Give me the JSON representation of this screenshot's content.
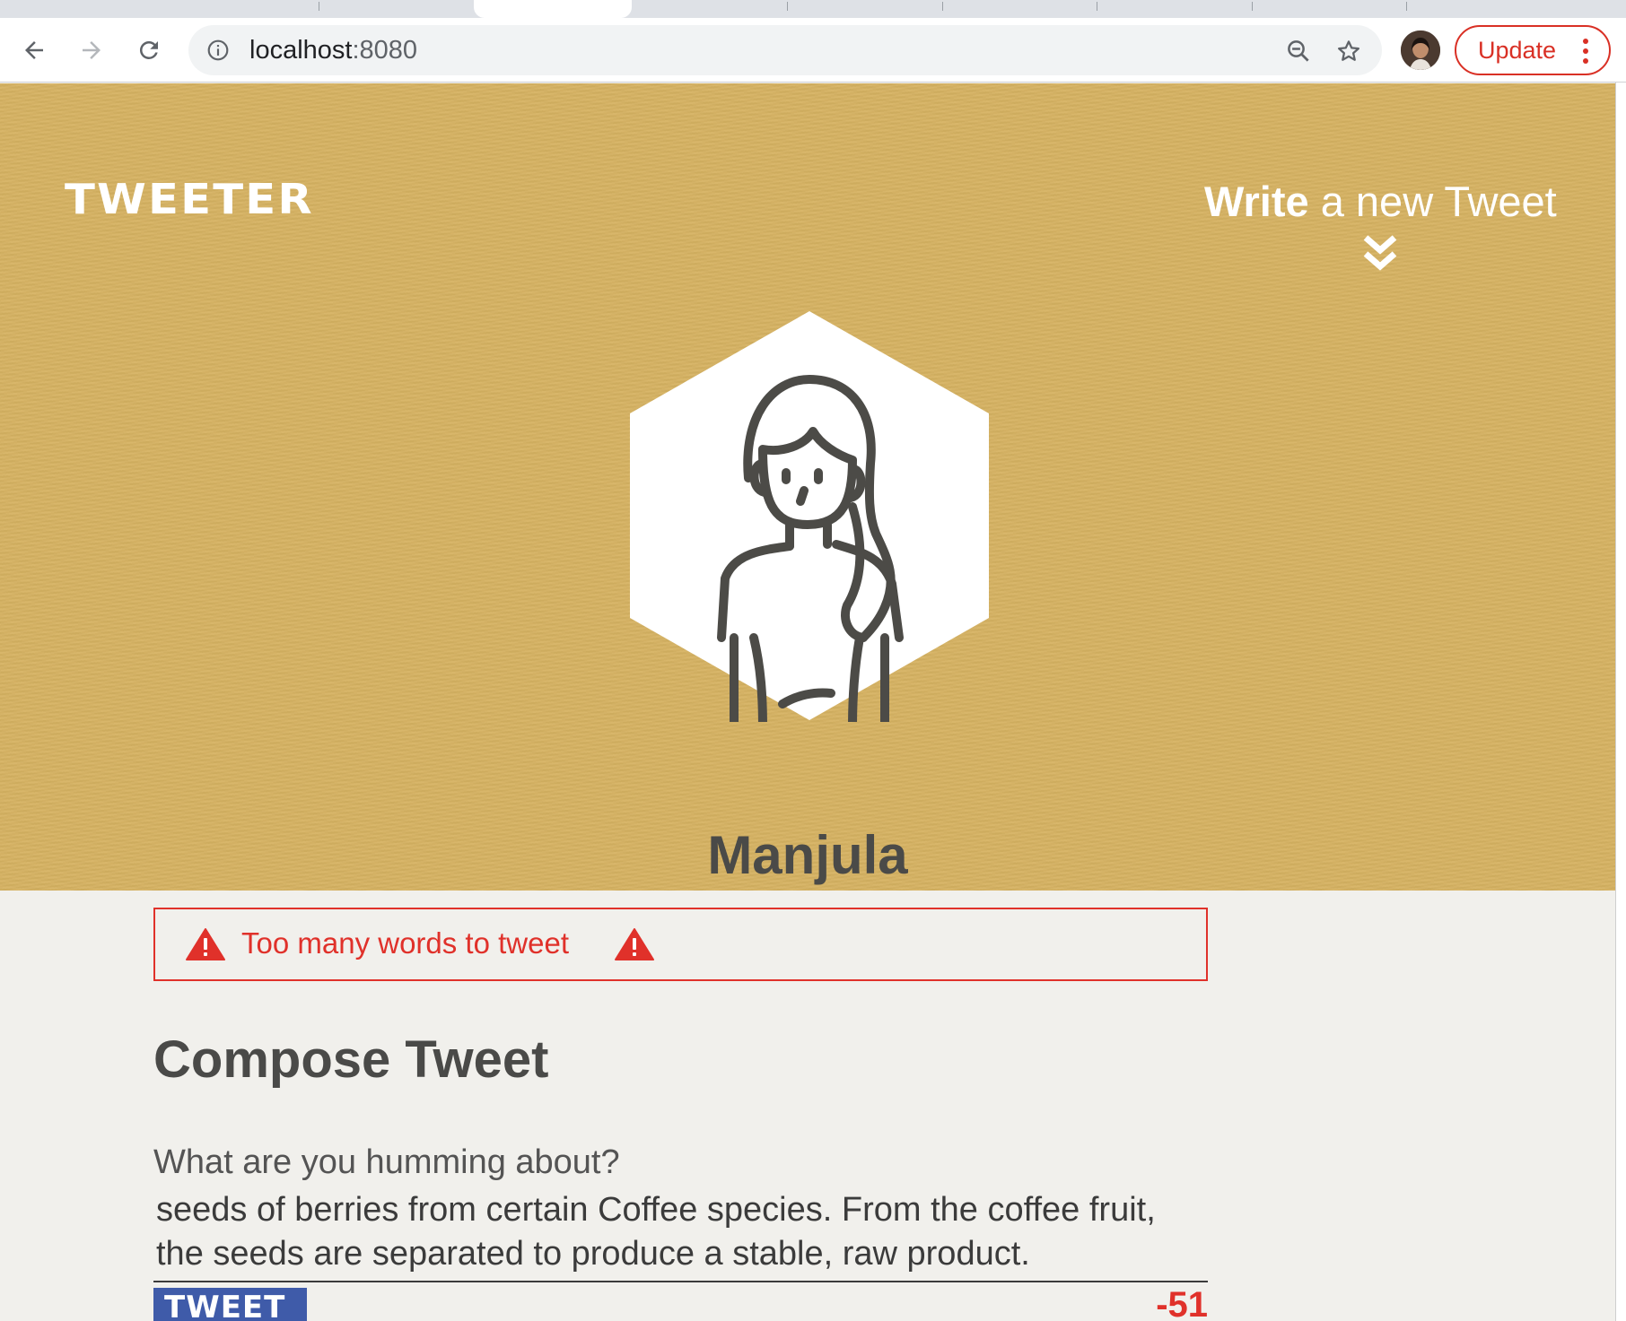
{
  "browser": {
    "url_host": "localhost",
    "url_port": ":8080",
    "update_label": "Update",
    "icons": {
      "back": "arrow-left-icon",
      "forward": "arrow-right-icon",
      "reload": "reload-icon",
      "site_info": "info-icon",
      "zoom": "zoom-out-icon",
      "bookmark": "star-icon",
      "menu": "kebab-menu-icon"
    }
  },
  "header": {
    "logo": "TWEETER",
    "write_bold": "Write",
    "write_rest": " a new Tweet",
    "user_name": "Manjula",
    "colors": {
      "background": "#d6b262",
      "text": "#ffffff",
      "name": "#4a4a48"
    }
  },
  "compose": {
    "error_message": "Too many words to tweet",
    "title": "Compose Tweet",
    "label": "What are you humming about?",
    "text": "seeds of berries from certain Coffee species. From the coffee fruit, the seeds are separated to produce a stable, raw product.",
    "button_label": "TWEET",
    "counter": "-51",
    "colors": {
      "error": "#e0312a",
      "button": "#3f5ba9",
      "counter": "#e0312a"
    }
  }
}
